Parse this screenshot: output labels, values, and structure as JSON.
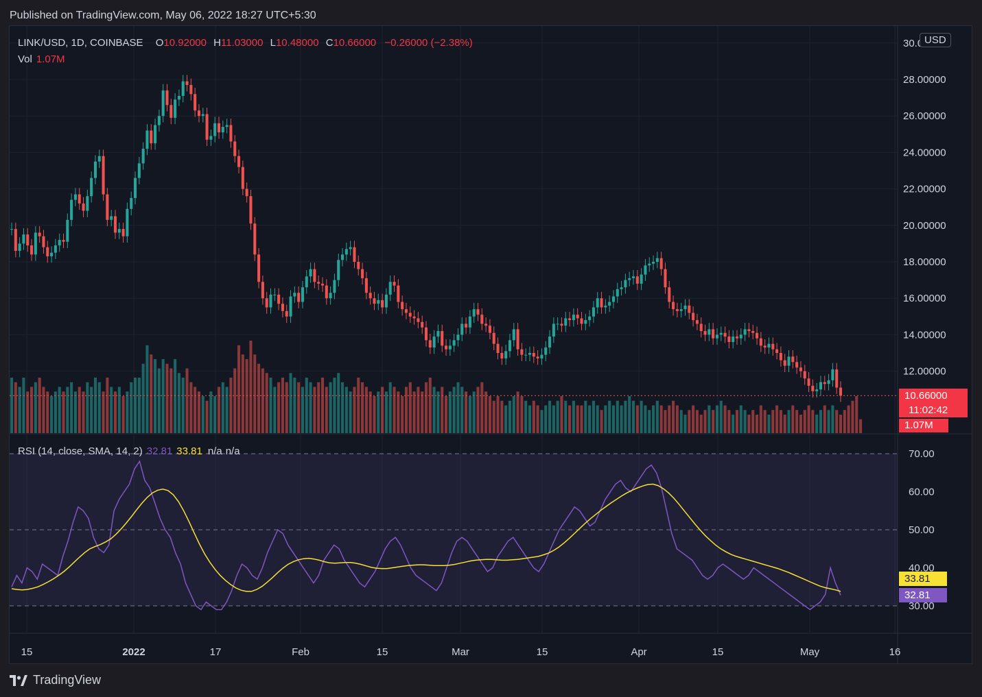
{
  "published": "Published on TradingView.com, May 06, 2022 18:27 UTC+5:30",
  "legend": {
    "symbol": "LINK/USD, 1D, COINBASE",
    "o_label": "O",
    "o_value": "10.92000",
    "h_label": "H",
    "h_value": "11.03000",
    "l_label": "L",
    "l_value": "10.48000",
    "c_label": "C",
    "c_value": "10.66000",
    "change": "−0.26000 (−2.38%)"
  },
  "volume_legend": {
    "label": "Vol",
    "value": "1.07M"
  },
  "rsi_legend": {
    "label": "RSI (14, close, SMA, 14, 2)",
    "rsi_value": "32.81",
    "sma_value": "33.81",
    "na1": "n/a",
    "na2": "n/a"
  },
  "currency_badge": "USD",
  "price_scale": {
    "top_partial": "30.00000",
    "ticks": [
      "28.00000",
      "26.00000",
      "24.00000",
      "22.00000",
      "20.00000",
      "18.00000",
      "16.00000",
      "14.00000",
      "12.00000"
    ]
  },
  "last_price_tag": {
    "price": "10.66000",
    "countdown": "11:02:42",
    "volume": "1.07M"
  },
  "rsi_scale": {
    "ticks": [
      "70.00",
      "60.00",
      "50.00",
      "40.00",
      "30.00"
    ]
  },
  "rsi_tags": {
    "sma": "33.81",
    "rsi": "32.81"
  },
  "time_axis": [
    "15",
    "2022",
    "17",
    "Feb",
    "15",
    "Mar",
    "15",
    "Apr",
    "15",
    "May",
    "16"
  ],
  "footer_brand": "TradingView",
  "colors": {
    "up": "#26a69a",
    "down": "#ef5350",
    "rsi": "#7e57c2",
    "sma": "#f7e135",
    "background": "#131722"
  },
  "chart_data": [
    {
      "type": "candlestick",
      "symbol": "LINK/USD",
      "interval": "1D",
      "ylim": [
        10.0,
        30.0
      ],
      "closes": [
        19.8,
        18.6,
        19.0,
        19.5,
        18.9,
        18.4,
        19.6,
        19.4,
        18.8,
        18.3,
        18.5,
        18.9,
        19.2,
        19.1,
        20.3,
        21.4,
        21.7,
        21.2,
        20.8,
        21.6,
        22.6,
        23.5,
        23.8,
        21.7,
        20.3,
        20.5,
        19.6,
        19.8,
        19.4,
        20.9,
        21.5,
        22.6,
        23.4,
        24.2,
        25.2,
        24.5,
        25.5,
        26.0,
        27.4,
        26.6,
        25.9,
        26.9,
        27.1,
        27.9,
        27.7,
        27.2,
        26.3,
        26.0,
        26.1,
        24.7,
        24.9,
        25.6,
        25.1,
        25.4,
        25.5,
        24.6,
        23.8,
        23.2,
        22.0,
        21.6,
        20.1,
        18.4,
        16.9,
        16.0,
        15.5,
        16.2,
        16.2,
        15.7,
        15.3,
        15.0,
        16.1,
        16.3,
        15.8,
        16.6,
        17.2,
        17.6,
        16.9,
        16.8,
        16.7,
        16.0,
        16.3,
        17.0,
        18.1,
        18.4,
        18.7,
        18.8,
        18.0,
        17.6,
        17.1,
        16.3,
        16.0,
        15.7,
        15.9,
        15.5,
        16.2,
        16.9,
        16.7,
        15.8,
        15.4,
        15.2,
        15.0,
        14.9,
        14.7,
        14.4,
        13.7,
        13.3,
        13.9,
        14.2,
        13.4,
        13.2,
        13.4,
        13.7,
        14.0,
        14.6,
        14.4,
        15.0,
        15.4,
        15.1,
        14.6,
        14.5,
        14.1,
        13.5,
        13.0,
        12.7,
        13.1,
        13.7,
        14.3,
        13.2,
        12.9,
        12.9,
        13.0,
        12.8,
        12.7,
        12.9,
        13.3,
        13.9,
        14.6,
        14.6,
        14.5,
        14.9,
        14.8,
        15.1,
        14.9,
        14.6,
        14.8,
        15.0,
        15.5,
        16.0,
        15.5,
        15.6,
        15.8,
        16.1,
        16.5,
        16.6,
        17.0,
        17.1,
        17.2,
        16.8,
        17.3,
        17.8,
        17.9,
        18.0,
        18.2,
        17.6,
        16.6,
        15.8,
        15.4,
        15.3,
        15.4,
        15.6,
        15.2,
        14.8,
        14.6,
        14.2,
        14.0,
        14.3,
        13.8,
        14.0,
        14.1,
        13.9,
        13.6,
        13.9,
        13.8,
        14.0,
        14.3,
        14.2,
        14.1,
        13.8,
        13.4,
        13.3,
        13.5,
        13.2,
        13.0,
        12.6,
        12.3,
        12.8,
        12.5,
        12.2,
        12.0,
        11.6,
        11.2,
        10.9,
        11.0,
        11.4,
        11.3,
        11.5,
        12.1,
        11.1,
        10.66
      ]
    },
    {
      "type": "bar",
      "series_name": "Vol",
      "scale": "relative",
      "values": [
        0.6,
        0.55,
        0.5,
        0.6,
        0.45,
        0.5,
        0.55,
        0.6,
        0.5,
        0.45,
        0.4,
        0.45,
        0.5,
        0.45,
        0.5,
        0.55,
        0.45,
        0.5,
        0.45,
        0.55,
        0.5,
        0.6,
        0.55,
        0.45,
        0.6,
        0.5,
        0.45,
        0.5,
        0.4,
        0.45,
        0.55,
        0.6,
        0.6,
        0.75,
        0.95,
        0.85,
        0.8,
        0.7,
        0.8,
        0.75,
        0.7,
        0.8,
        0.65,
        0.6,
        0.7,
        0.55,
        0.5,
        0.45,
        0.4,
        0.35,
        0.45,
        0.4,
        0.5,
        0.55,
        0.5,
        0.6,
        0.7,
        0.95,
        0.85,
        0.8,
        1.0,
        0.85,
        0.75,
        0.7,
        0.65,
        0.6,
        0.5,
        0.55,
        0.6,
        0.55,
        0.65,
        0.6,
        0.55,
        0.5,
        0.6,
        0.55,
        0.5,
        0.55,
        0.6,
        0.5,
        0.55,
        0.6,
        0.65,
        0.55,
        0.5,
        0.45,
        0.5,
        0.6,
        0.55,
        0.5,
        0.45,
        0.4,
        0.45,
        0.5,
        0.45,
        0.55,
        0.5,
        0.45,
        0.4,
        0.5,
        0.55,
        0.45,
        0.5,
        0.45,
        0.55,
        0.6,
        0.5,
        0.45,
        0.5,
        0.4,
        0.45,
        0.5,
        0.55,
        0.5,
        0.45,
        0.4,
        0.45,
        0.5,
        0.55,
        0.45,
        0.4,
        0.35,
        0.4,
        0.35,
        0.3,
        0.35,
        0.4,
        0.45,
        0.4,
        0.35,
        0.3,
        0.35,
        0.3,
        0.25,
        0.3,
        0.35,
        0.3,
        0.35,
        0.4,
        0.35,
        0.3,
        0.35,
        0.3,
        0.3,
        0.35,
        0.3,
        0.35,
        0.3,
        0.25,
        0.3,
        0.35,
        0.3,
        0.35,
        0.3,
        0.35,
        0.4,
        0.35,
        0.3,
        0.35,
        0.3,
        0.25,
        0.3,
        0.35,
        0.3,
        0.25,
        0.3,
        0.35,
        0.3,
        0.25,
        0.2,
        0.25,
        0.3,
        0.25,
        0.2,
        0.25,
        0.3,
        0.25,
        0.3,
        0.35,
        0.3,
        0.25,
        0.2,
        0.25,
        0.3,
        0.25,
        0.2,
        0.25,
        0.2,
        0.3,
        0.25,
        0.2,
        0.25,
        0.3,
        0.25,
        0.2,
        0.25,
        0.3,
        0.25,
        0.2,
        0.25,
        0.3,
        0.25,
        0.2,
        0.25,
        0.3,
        0.25,
        0.3,
        0.25,
        0.2,
        0.25,
        0.3,
        0.35,
        0.4,
        0.15
      ]
    },
    {
      "type": "line",
      "title": "RSI (14, close, SMA, 14, 2)",
      "ylim": [
        23,
        72
      ],
      "series": [
        {
          "name": "RSI",
          "values": [
            35,
            38,
            36,
            40,
            39,
            37,
            41,
            40,
            39,
            38,
            43,
            47,
            52,
            56,
            55,
            53,
            48,
            45,
            44,
            46,
            55,
            58,
            60,
            62,
            66,
            68,
            63,
            61,
            57,
            53,
            50,
            48,
            44,
            41,
            36,
            33,
            30,
            29,
            31,
            30,
            29,
            29,
            31,
            34,
            38,
            41,
            40,
            38,
            37,
            40,
            44,
            47,
            50,
            49,
            46,
            44,
            42,
            40,
            38,
            36,
            38,
            42,
            44,
            46,
            45,
            42,
            40,
            38,
            36,
            35,
            37,
            39,
            42,
            45,
            47,
            48,
            46,
            43,
            40,
            38,
            37,
            36,
            35,
            34,
            36,
            40,
            44,
            47,
            48,
            47,
            45,
            43,
            41,
            39,
            40,
            43,
            45,
            47,
            48,
            46,
            44,
            42,
            40,
            39,
            41,
            44,
            47,
            50,
            52,
            54,
            56,
            55,
            53,
            51,
            52,
            55,
            58,
            60,
            62,
            63,
            61,
            60,
            62,
            64,
            66,
            67,
            65,
            61,
            55,
            49,
            45,
            44,
            43,
            42,
            40,
            38,
            37,
            38,
            40,
            41,
            40,
            39,
            38,
            37,
            38,
            40,
            39,
            38,
            37,
            36,
            35,
            34,
            33,
            32,
            31,
            30,
            29,
            30,
            31,
            33,
            40,
            36,
            32.81
          ]
        },
        {
          "name": "SMA",
          "values": [
            34.5,
            34.3,
            34.2,
            34.3,
            34.6,
            35,
            35.6,
            36.3,
            37.1,
            38,
            39,
            40.2,
            41.5,
            42.8,
            44,
            45,
            45.6,
            46.1,
            46.8,
            47.6,
            48.8,
            50.2,
            51.8,
            53.5,
            55.3,
            57,
            58.5,
            59.7,
            60.4,
            60.7,
            60.3,
            59.2,
            57.4,
            55,
            52.2,
            49.2,
            46.3,
            43.7,
            41.5,
            39.6,
            38,
            36.7,
            35.6,
            34.7,
            34.1,
            33.8,
            33.8,
            34.3,
            35.1,
            36.2,
            37.4,
            38.7,
            39.9,
            40.9,
            41.6,
            42.1,
            42.4,
            42.5,
            42.3,
            42,
            41.6,
            41.3,
            41.2,
            41.3,
            41.4,
            41.4,
            41.2,
            40.9,
            40.5,
            40.1,
            39.9,
            39.8,
            39.8,
            40,
            40.2,
            40.4,
            40.6,
            40.7,
            40.8,
            40.8,
            40.7,
            40.6,
            40.6,
            40.6,
            40.7,
            40.9,
            41.2,
            41.5,
            41.8,
            42,
            42.1,
            42.2,
            42.2,
            42.1,
            42,
            42,
            42.1,
            42.2,
            42.4,
            42.6,
            42.8,
            43,
            43.4,
            43.9,
            44.6,
            45.5,
            46.6,
            47.8,
            49.1,
            50.4,
            51.7,
            52.9,
            54,
            55.1,
            56.1,
            57.1,
            58,
            58.9,
            59.7,
            60.4,
            61,
            61.5,
            61.9,
            62,
            61.6,
            60.8,
            59.7,
            58.3,
            56.7,
            55,
            53.3,
            51.6,
            50,
            48.5,
            47.2,
            46,
            45,
            44.2,
            43.5,
            43,
            42.6,
            42.2,
            41.8,
            41.4,
            41,
            40.6,
            40.2,
            39.8,
            39.3,
            38.8,
            38.2,
            37.6,
            37,
            36.4,
            35.8,
            35.2,
            34.8,
            34.5,
            34.2,
            33.81
          ]
        }
      ],
      "levels": [
        70,
        50,
        30
      ]
    }
  ]
}
